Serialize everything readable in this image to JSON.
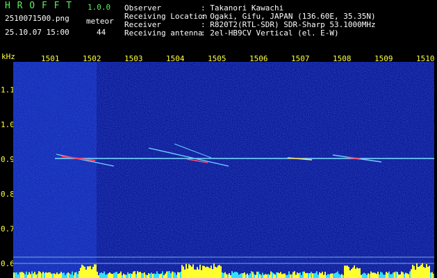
{
  "app": {
    "title": "H R O F F T",
    "version": "1.0.0"
  },
  "file": {
    "name": "2510071500.png",
    "datetime": "25.10.07 15:00"
  },
  "meteor": {
    "label": "meteor",
    "count": "44"
  },
  "info": [
    {
      "key": "Observer",
      "value": ": Takanori Kawachi"
    },
    {
      "key": "Receiving Location",
      "value": ": Ogaki, Gifu, JAPAN (136.60E, 35.35N)"
    },
    {
      "key": "Receiver",
      "value": ": R820T2(RTL-SDR) SDR-Sharp 53.1000MHz"
    },
    {
      "key": "Receiving antenna",
      "value": ": 2el-HB9CV Vertical (el. E-W)"
    }
  ],
  "axis": {
    "unit": "kHz",
    "time_ticks": [
      "1501",
      "1502",
      "1503",
      "1504",
      "1505",
      "1506",
      "1507",
      "1508",
      "1509",
      "1510"
    ],
    "freq_ticks": [
      "1.1",
      "1.0",
      "0.9",
      "0.8",
      "0.7",
      "0.6"
    ]
  },
  "colors": {
    "title_green": "#5cf05c",
    "axis_yellow": "#ffff40",
    "background_blue": "#0a1a9a"
  }
}
